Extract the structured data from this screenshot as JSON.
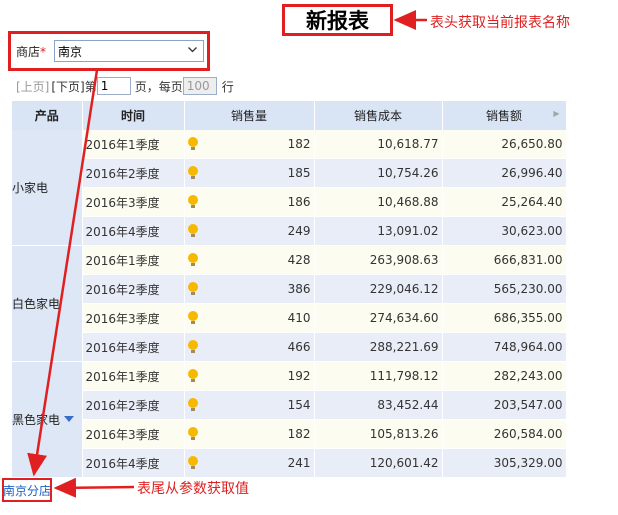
{
  "report": {
    "title": "新报表",
    "title_annotation": "表头获取当前报表名称",
    "footer_value": "南京分店",
    "footer_annotation": "表尾从参数获取值"
  },
  "filter": {
    "label": "商店",
    "required_mark": "*",
    "selected": "南京"
  },
  "pager": {
    "prev": "[上页]",
    "next": "[下页]",
    "page_prefix": "第",
    "page_value": "1",
    "page_suffix": "页，每页",
    "rows_value": "100",
    "rows_suffix": "行"
  },
  "table": {
    "columns": [
      "产品",
      "时间",
      "销售量",
      "销售成本",
      "销售额"
    ],
    "groups": [
      {
        "product": "小家电",
        "rows": [
          {
            "time": "2016年1季度",
            "qty": "182",
            "cost": "10,618.77",
            "amount": "26,650.80"
          },
          {
            "time": "2016年2季度",
            "qty": "185",
            "cost": "10,754.26",
            "amount": "26,996.40"
          },
          {
            "time": "2016年3季度",
            "qty": "186",
            "cost": "10,468.88",
            "amount": "25,264.40"
          },
          {
            "time": "2016年4季度",
            "qty": "249",
            "cost": "13,091.02",
            "amount": "30,623.00"
          }
        ]
      },
      {
        "product": "白色家电",
        "rows": [
          {
            "time": "2016年1季度",
            "qty": "428",
            "cost": "263,908.63",
            "amount": "666,831.00"
          },
          {
            "time": "2016年2季度",
            "qty": "386",
            "cost": "229,046.12",
            "amount": "565,230.00"
          },
          {
            "time": "2016年3季度",
            "qty": "410",
            "cost": "274,634.60",
            "amount": "686,355.00"
          },
          {
            "time": "2016年4季度",
            "qty": "466",
            "cost": "288,221.69",
            "amount": "748,964.00"
          }
        ]
      },
      {
        "product": "黑色家电",
        "rows": [
          {
            "time": "2016年1季度",
            "qty": "192",
            "cost": "111,798.12",
            "amount": "282,243.00"
          },
          {
            "time": "2016年2季度",
            "qty": "154",
            "cost": "83,452.44",
            "amount": "203,547.00"
          },
          {
            "time": "2016年3季度",
            "qty": "182",
            "cost": "105,813.26",
            "amount": "260,584.00"
          },
          {
            "time": "2016年4季度",
            "qty": "241",
            "cost": "120,601.42",
            "amount": "305,329.00"
          }
        ]
      }
    ]
  },
  "colors": {
    "annotation_red": "#e02020",
    "header_bg": "#d9e4f4",
    "row_light": "#fcfcf0",
    "row_blue": "#e9edf8",
    "footer_link": "#1a5fc4"
  },
  "icons": {
    "indicator": "lightbulb-icon",
    "select": "chevron-down-icon",
    "expand": "caret-down-icon"
  }
}
